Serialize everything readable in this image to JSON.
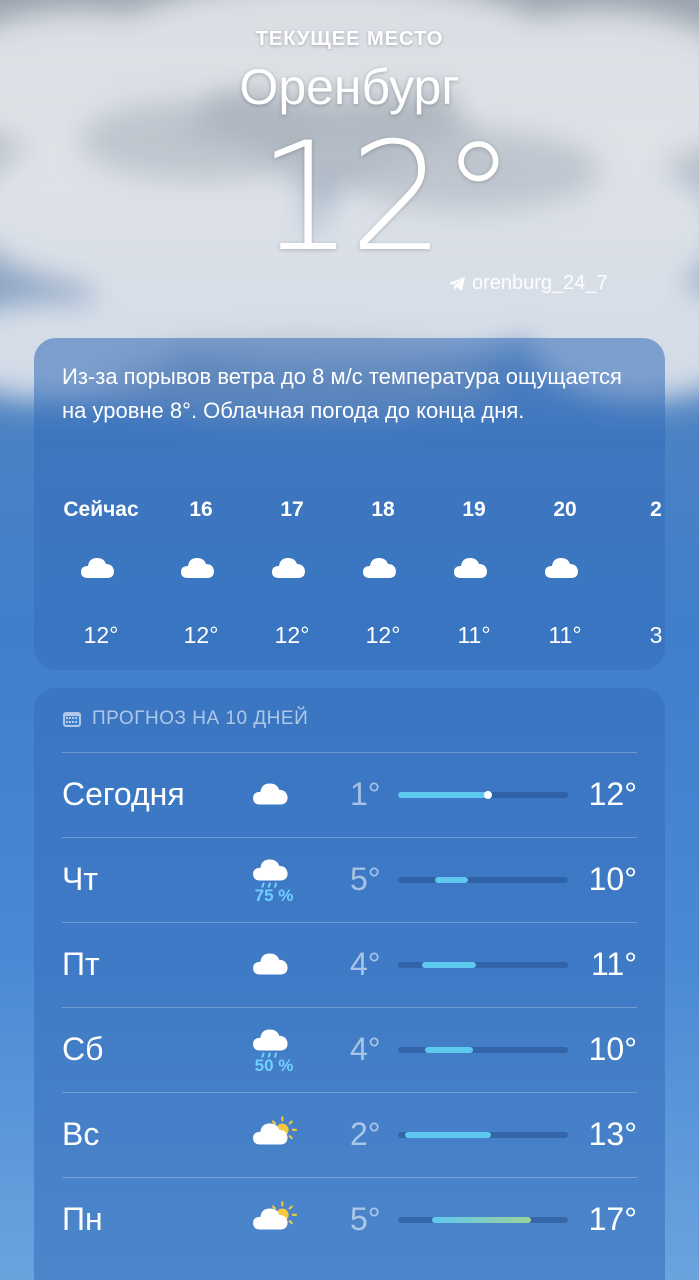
{
  "header": {
    "location_label": "ТЕКУЩЕЕ МЕСТО",
    "city": "Оренбург",
    "temperature": "12°",
    "watermark": "orenburg_24_7",
    "watermark_icon": "telegram-icon"
  },
  "hourly": {
    "summary": "Из-за порывов ветра до 8 м/с температура ощущается на уровне 8°. Облачная погода до конца дня.",
    "items": [
      {
        "label": "Сейчас",
        "icon": "cloud-icon",
        "temp": "12°"
      },
      {
        "label": "16",
        "icon": "cloud-icon",
        "temp": "12°"
      },
      {
        "label": "17",
        "icon": "cloud-icon",
        "temp": "12°"
      },
      {
        "label": "18",
        "icon": "cloud-icon",
        "temp": "12°"
      },
      {
        "label": "19",
        "icon": "cloud-icon",
        "temp": "11°"
      },
      {
        "label": "20",
        "icon": "cloud-icon",
        "temp": "11°"
      },
      {
        "label": "2",
        "icon": "",
        "temp": "3"
      }
    ]
  },
  "daily": {
    "title": "ПРОГНОЗ НА 10 ДНЕЙ",
    "title_icon": "calendar-icon",
    "colors": {
      "cool": "#5ec8ee",
      "warm": "#9bd29a"
    },
    "items": [
      {
        "day": "Сегодня",
        "icon": "cloud-icon",
        "prob": "",
        "low": "1°",
        "high": "12°",
        "range_start": 0.0,
        "range_end": 0.53,
        "current": 0.53
      },
      {
        "day": "Чт",
        "icon": "cloud-rain-icon",
        "prob": "75 %",
        "low": "5°",
        "high": "10°",
        "range_start": 0.22,
        "range_end": 0.41,
        "current": null
      },
      {
        "day": "Пт",
        "icon": "cloud-icon",
        "prob": "",
        "low": "4°",
        "high": "11°",
        "range_start": 0.14,
        "range_end": 0.46,
        "current": null
      },
      {
        "day": "Сб",
        "icon": "cloud-rain-icon",
        "prob": "50 %",
        "low": "4°",
        "high": "10°",
        "range_start": 0.16,
        "range_end": 0.44,
        "current": null
      },
      {
        "day": "Вс",
        "icon": "cloud-sun-icon",
        "prob": "",
        "low": "2°",
        "high": "13°",
        "range_start": 0.04,
        "range_end": 0.55,
        "current": null
      },
      {
        "day": "Пн",
        "icon": "cloud-sun-icon",
        "prob": "",
        "low": "5°",
        "high": "17°",
        "range_start": 0.2,
        "range_end": 0.78,
        "current": null
      }
    ]
  }
}
